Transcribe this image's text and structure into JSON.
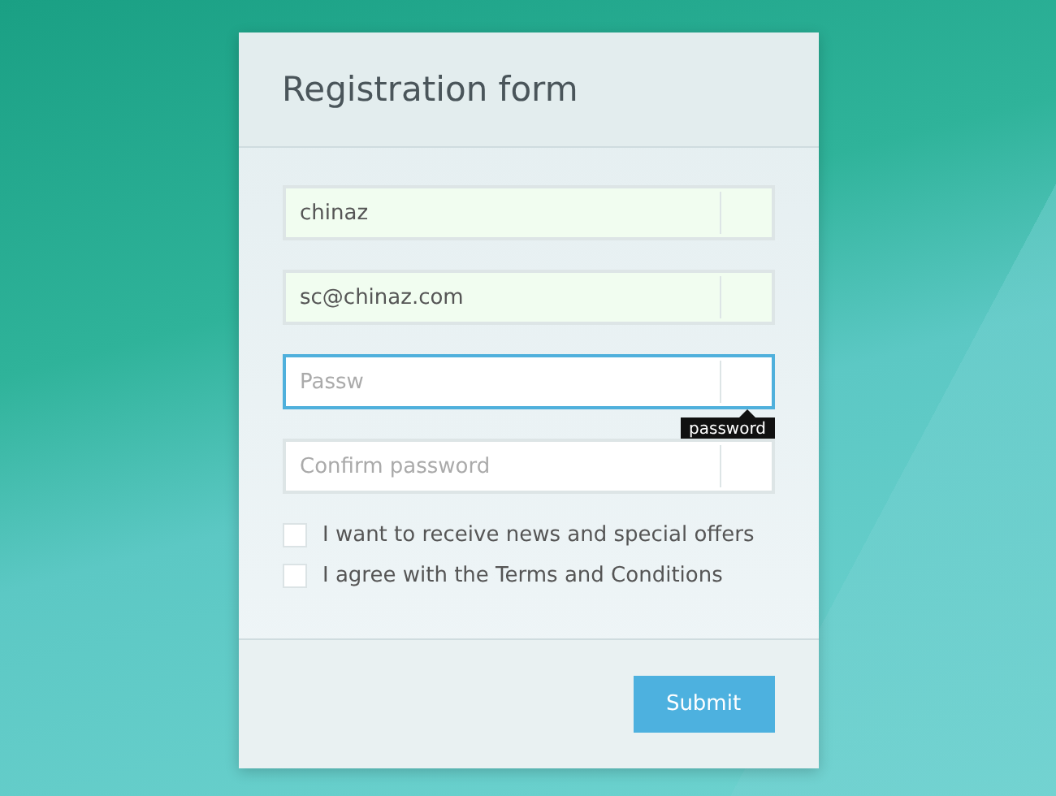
{
  "form": {
    "title": "Registration form",
    "fields": [
      {
        "value": "chinaz",
        "valid": true,
        "focused": false
      },
      {
        "value": "sc@chinaz.com",
        "valid": true,
        "focused": false
      },
      {
        "placeholder": "Passw",
        "valid": false,
        "focused": true,
        "tooltip": "password"
      },
      {
        "placeholder": "Confirm password",
        "valid": false,
        "focused": false
      }
    ],
    "checkboxes": [
      {
        "label": "I want to receive news and special offers",
        "checked": false
      },
      {
        "label": "I agree with the Terms and Conditions",
        "checked": false
      }
    ],
    "submit": "Submit"
  }
}
